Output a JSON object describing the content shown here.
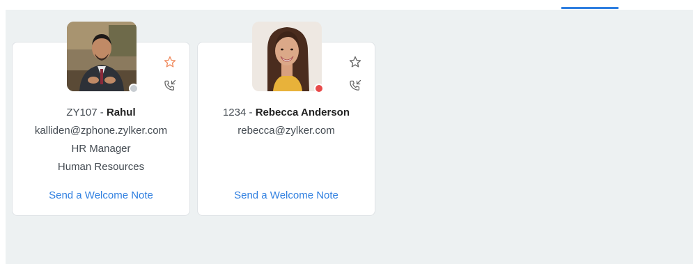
{
  "colors": {
    "accent": "#2f7fe0",
    "favorite_active": "#f08a5d",
    "icon_default": "#666666",
    "status_away": "#c8cdd2",
    "status_busy": "#e84a4a",
    "background": "#edf1f2"
  },
  "cards": [
    {
      "extension": "ZY107",
      "separator": " - ",
      "name": "Rahul",
      "email": "kalliden@zphone.zylker.com",
      "title": "HR Manager",
      "department": "Human Resources",
      "favorite_icon": "star-icon",
      "favorite": true,
      "call_icon": "phone-incoming-icon",
      "status": "away",
      "action_label": "Send a Welcome Note"
    },
    {
      "extension": "1234",
      "separator": " - ",
      "name": "Rebecca Anderson",
      "email": "rebecca@zylker.com",
      "title": "",
      "department": "",
      "favorite_icon": "star-icon",
      "favorite": false,
      "call_icon": "phone-incoming-icon",
      "status": "busy",
      "action_label": "Send a Welcome Note"
    }
  ]
}
